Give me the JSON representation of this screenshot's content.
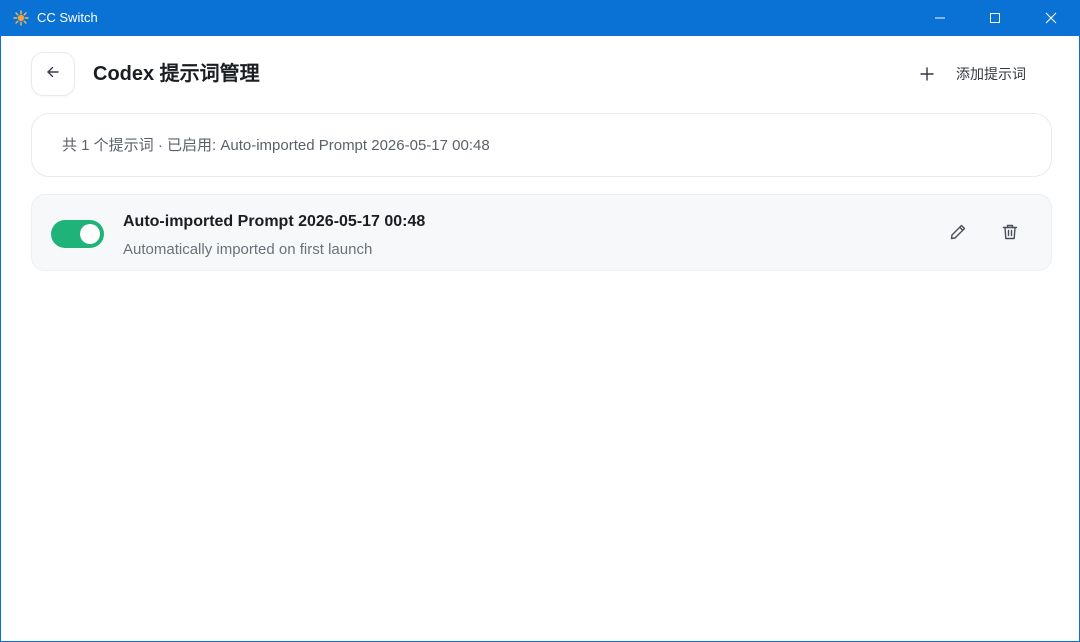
{
  "window": {
    "title": "CC Switch",
    "icons": {
      "app": "cc-switch-logo-icon",
      "minimize": "minimize-icon",
      "maximize": "maximize-icon",
      "close": "close-icon"
    },
    "colors": {
      "titlebar": "#0a72d4"
    }
  },
  "header": {
    "title": "Codex 提示词管理",
    "back_icon": "arrow-left-icon",
    "add_button": {
      "label": "添加提示词",
      "icon": "plus-icon"
    }
  },
  "summary": {
    "text": "共 1 个提示词 · 已启用: Auto-imported Prompt 2026-05-17 00:48"
  },
  "prompts": [
    {
      "enabled": true,
      "title": "Auto-imported Prompt 2026-05-17 00:48",
      "description": "Automatically imported on first launch",
      "actions": [
        "pencil-icon",
        "trash-icon"
      ]
    }
  ],
  "colors": {
    "toggle_on": "#1fb37a",
    "card_bg": "#f7f8f9"
  }
}
